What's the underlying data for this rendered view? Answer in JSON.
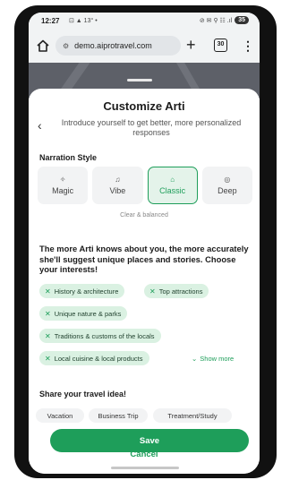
{
  "status_bar": {
    "time": "12:27",
    "left_icons": "⊡ ▲ 13° •",
    "right_icons": "⊘ ✉ ⚲ ☷ .ıl",
    "battery": "35"
  },
  "browser": {
    "url": "demo.aiprotravel.com",
    "tab_count": "30"
  },
  "sheet": {
    "title": "Customize Arti",
    "subtitle": "Introduce yourself to get better, more personalized responses",
    "narration_label": "Narration Style",
    "styles": [
      {
        "label": "Magic",
        "icon": "✧"
      },
      {
        "label": "Vibe",
        "icon": "♫"
      },
      {
        "label": "Classic",
        "icon": "⌂"
      },
      {
        "label": "Deep",
        "icon": "◎"
      }
    ],
    "selected_style": "Classic",
    "style_caption": "Clear & balanced",
    "intro": "The more Arti knows about you, the more accurately she'll suggest unique places and stories. Choose your interests!",
    "interests": [
      "History & architecture",
      "Top attractions",
      "Unique nature & parks",
      "Traditions & customs of the locals",
      "Local cuisine & local products"
    ],
    "show_more": "Show more",
    "share_label": "Share your travel idea!",
    "trip_types": [
      "Vacation",
      "Business Trip",
      "Treatment/Study"
    ],
    "save_label": "Save",
    "cancel_label": "Cancel"
  },
  "colors": {
    "accent": "#1e9e5a",
    "chip_bg": "#daf1e2"
  }
}
